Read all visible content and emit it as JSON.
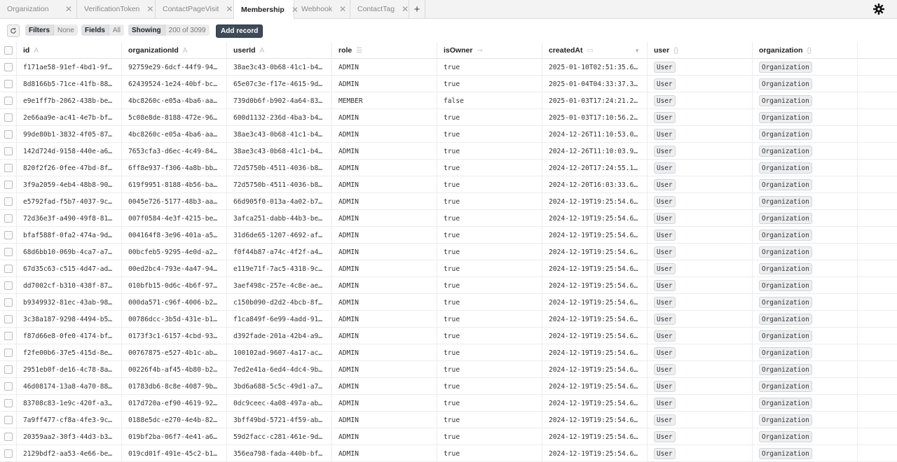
{
  "tabs": [
    {
      "label": "Organization",
      "active": false
    },
    {
      "label": "VerificationToken",
      "active": false
    },
    {
      "label": "ContactPageVisit",
      "active": false
    },
    {
      "label": "Membership",
      "active": true
    },
    {
      "label": "Webhook",
      "active": false
    },
    {
      "label": "ContactTag",
      "active": false
    }
  ],
  "add_tab_label": "+",
  "toolbar": {
    "filters_label": "Filters",
    "filters_value": "None",
    "fields_label": "Fields",
    "fields_value": "All",
    "showing_label": "Showing",
    "showing_value": "200 of 3099",
    "add_record_label": "Add record"
  },
  "columns": [
    {
      "key": "id",
      "label": "id",
      "icon": "string-type-icon"
    },
    {
      "key": "organizationId",
      "label": "organizationId",
      "icon": "string-type-icon"
    },
    {
      "key": "userId",
      "label": "userId",
      "icon": "string-type-icon"
    },
    {
      "key": "role",
      "label": "role",
      "icon": "enum-type-icon"
    },
    {
      "key": "isOwner",
      "label": "isOwner",
      "icon": "boolean-type-icon"
    },
    {
      "key": "createdAt",
      "label": "createdAt",
      "icon": "datetime-type-icon",
      "sorted": "desc"
    },
    {
      "key": "user",
      "label": "user",
      "icon": "relation-type-icon"
    },
    {
      "key": "organization",
      "label": "organization",
      "icon": "relation-type-icon"
    }
  ],
  "rows": [
    {
      "id": "f171ae58-91ef-4bd1-9f…",
      "organizationId": "92759e29-6dcf-44f9-94…",
      "userId": "38ae3c43-0b68-41c1-b4…",
      "role": "ADMIN",
      "isOwner": "true",
      "createdAt": "2025-01-10T02:51:35.6…",
      "user": "User",
      "organization": "Organization"
    },
    {
      "id": "8d8166b5-71ce-41fb-88…",
      "organizationId": "62439524-1e24-40bf-bc…",
      "userId": "65e07c3e-f17e-4615-9d…",
      "role": "ADMIN",
      "isOwner": "true",
      "createdAt": "2025-01-04T04:33:37.3…",
      "user": "User",
      "organization": "Organization"
    },
    {
      "id": "e9e1ff7b-2062-438b-be…",
      "organizationId": "4bc8260c-e05a-4ba6-aa…",
      "userId": "739d0b6f-b902-4a64-83…",
      "role": "MEMBER",
      "isOwner": "false",
      "createdAt": "2025-01-03T17:24:21.2…",
      "user": "User",
      "organization": "Organization"
    },
    {
      "id": "2e66aa9e-ac41-4e7b-bf…",
      "organizationId": "5c08e8de-8188-472e-96…",
      "userId": "600d1132-236d-4ba3-b4…",
      "role": "ADMIN",
      "isOwner": "true",
      "createdAt": "2025-01-03T17:10:56.2…",
      "user": "User",
      "organization": "Organization"
    },
    {
      "id": "99de80b1-3832-4f05-87…",
      "organizationId": "4bc8260c-e05a-4ba6-aa…",
      "userId": "38ae3c43-0b68-41c1-b4…",
      "role": "ADMIN",
      "isOwner": "true",
      "createdAt": "2024-12-26T11:10:53.0…",
      "user": "User",
      "organization": "Organization"
    },
    {
      "id": "142d724d-9158-440e-a6…",
      "organizationId": "7653cfa3-d6ec-4c49-84…",
      "userId": "38ae3c43-0b68-41c1-b4…",
      "role": "ADMIN",
      "isOwner": "true",
      "createdAt": "2024-12-26T11:10:03.9…",
      "user": "User",
      "organization": "Organization"
    },
    {
      "id": "820f2f26-0fee-47bd-8f…",
      "organizationId": "6ff8e937-f306-4a8b-bb…",
      "userId": "72d5750b-4511-4036-b8…",
      "role": "ADMIN",
      "isOwner": "true",
      "createdAt": "2024-12-20T17:24:55.1…",
      "user": "User",
      "organization": "Organization"
    },
    {
      "id": "3f9a2059-4eb4-48b8-90…",
      "organizationId": "619f9951-8188-4b56-ba…",
      "userId": "72d5750b-4511-4036-b8…",
      "role": "ADMIN",
      "isOwner": "true",
      "createdAt": "2024-12-20T16:03:33.6…",
      "user": "User",
      "organization": "Organization"
    },
    {
      "id": "e5792fad-f5b7-4037-9c…",
      "organizationId": "0045e726-5177-48b3-aa…",
      "userId": "66d905f0-013a-4a02-b7…",
      "role": "ADMIN",
      "isOwner": "true",
      "createdAt": "2024-12-19T19:25:54.6…",
      "user": "User",
      "organization": "Organization"
    },
    {
      "id": "72d36e3f-a490-49f8-81…",
      "organizationId": "007f0584-4e3f-4215-be…",
      "userId": "3afca251-dabb-44b3-be…",
      "role": "ADMIN",
      "isOwner": "true",
      "createdAt": "2024-12-19T19:25:54.6…",
      "user": "User",
      "organization": "Organization"
    },
    {
      "id": "bfaf588f-0fa2-474a-9d…",
      "organizationId": "004164f8-3e96-401a-a5…",
      "userId": "31d6de65-1207-4692-af…",
      "role": "ADMIN",
      "isOwner": "true",
      "createdAt": "2024-12-19T19:25:54.6…",
      "user": "User",
      "organization": "Organization"
    },
    {
      "id": "68d6bb10-069b-4ca7-a7…",
      "organizationId": "00bcfeb5-9295-4e0d-a2…",
      "userId": "f0f44b87-a74c-4f2f-a4…",
      "role": "ADMIN",
      "isOwner": "true",
      "createdAt": "2024-12-19T19:25:54.6…",
      "user": "User",
      "organization": "Organization"
    },
    {
      "id": "67d35c63-c515-4d47-ad…",
      "organizationId": "00ed2bc4-793e-4a47-94…",
      "userId": "e119e71f-7ac5-4318-9c…",
      "role": "ADMIN",
      "isOwner": "true",
      "createdAt": "2024-12-19T19:25:54.6…",
      "user": "User",
      "organization": "Organization"
    },
    {
      "id": "dd7002cf-b310-438f-87…",
      "organizationId": "010bfb15-0d6c-4b6f-97…",
      "userId": "3aef498c-257e-4c8e-ae…",
      "role": "ADMIN",
      "isOwner": "true",
      "createdAt": "2024-12-19T19:25:54.6…",
      "user": "User",
      "organization": "Organization"
    },
    {
      "id": "b9349932-81ec-43ab-98…",
      "organizationId": "000da571-c96f-4006-b2…",
      "userId": "c150b090-d2d2-4bcb-8f…",
      "role": "ADMIN",
      "isOwner": "true",
      "createdAt": "2024-12-19T19:25:54.6…",
      "user": "User",
      "organization": "Organization"
    },
    {
      "id": "3c38a187-9298-4494-b5…",
      "organizationId": "00786dcc-3b5d-431e-b1…",
      "userId": "f1ca849f-6e99-4add-91…",
      "role": "ADMIN",
      "isOwner": "true",
      "createdAt": "2024-12-19T19:25:54.6…",
      "user": "User",
      "organization": "Organization"
    },
    {
      "id": "f87d66e8-0fe0-4174-bf…",
      "organizationId": "0173f3c1-6157-4cbd-93…",
      "userId": "d392fade-201a-42b4-a9…",
      "role": "ADMIN",
      "isOwner": "true",
      "createdAt": "2024-12-19T19:25:54.6…",
      "user": "User",
      "organization": "Organization"
    },
    {
      "id": "f2fe00b6-37e5-415d-8e…",
      "organizationId": "00767875-e527-4b1c-ab…",
      "userId": "100102ad-9607-4a17-ac…",
      "role": "ADMIN",
      "isOwner": "true",
      "createdAt": "2024-12-19T19:25:54.6…",
      "user": "User",
      "organization": "Organization"
    },
    {
      "id": "2951eb0f-de16-4c78-8a…",
      "organizationId": "00226f4b-af45-4b80-b2…",
      "userId": "7ed2e41a-6ed4-4dc4-9b…",
      "role": "ADMIN",
      "isOwner": "true",
      "createdAt": "2024-12-19T19:25:54.6…",
      "user": "User",
      "organization": "Organization"
    },
    {
      "id": "46d08174-13a8-4a70-88…",
      "organizationId": "01783db6-8c8e-4087-9b…",
      "userId": "3bd6a688-5c5c-49d1-a7…",
      "role": "ADMIN",
      "isOwner": "true",
      "createdAt": "2024-12-19T19:25:54.6…",
      "user": "User",
      "organization": "Organization"
    },
    {
      "id": "83708c83-1e9c-420f-a3…",
      "organizationId": "017d720a-ef90-4619-92…",
      "userId": "0dc9ceec-4a08-497a-ab…",
      "role": "ADMIN",
      "isOwner": "true",
      "createdAt": "2024-12-19T19:25:54.6…",
      "user": "User",
      "organization": "Organization"
    },
    {
      "id": "7a9ff477-cf8a-4fe3-9c…",
      "organizationId": "0188e5dc-e270-4e4b-82…",
      "userId": "3bff49bd-5721-4f59-ab…",
      "role": "ADMIN",
      "isOwner": "true",
      "createdAt": "2024-12-19T19:25:54.6…",
      "user": "User",
      "organization": "Organization"
    },
    {
      "id": "20359aa2-30f3-44d3-b3…",
      "organizationId": "019bf2ba-06f7-4e41-a6…",
      "userId": "59d2facc-c281-461e-9d…",
      "role": "ADMIN",
      "isOwner": "true",
      "createdAt": "2024-12-19T19:25:54.6…",
      "user": "User",
      "organization": "Organization"
    },
    {
      "id": "2129bdf2-aa53-4e66-be…",
      "organizationId": "019cd01f-491e-45c2-b1…",
      "userId": "356ea798-fada-440b-bf…",
      "role": "ADMIN",
      "isOwner": "true",
      "createdAt": "2024-12-19T19:25:54.6…",
      "user": "User",
      "organization": "Organization"
    }
  ]
}
